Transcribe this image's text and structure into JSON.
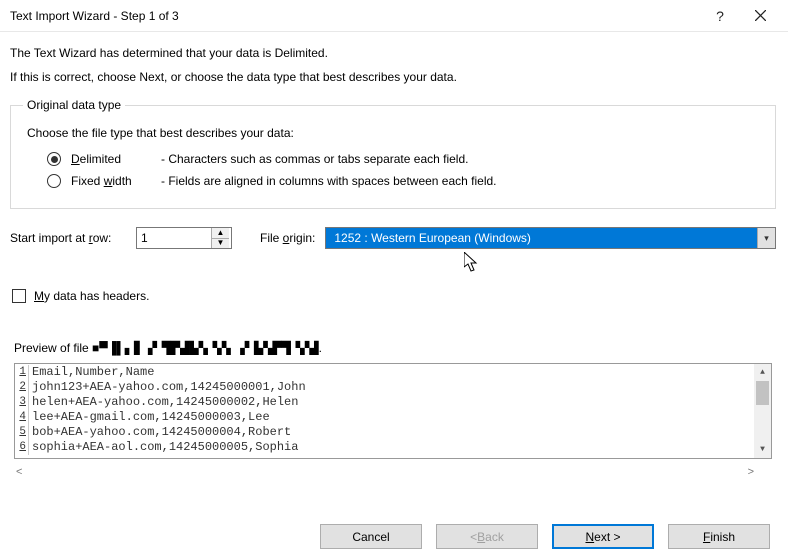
{
  "window": {
    "title": "Text Import Wizard - Step 1 of 3"
  },
  "intro": {
    "line1": "The Text Wizard has determined that your data is Delimited.",
    "line2": "If this is correct, choose Next, or choose the data type that best describes your data."
  },
  "group": {
    "legend": "Original data type",
    "prompt": "Choose the file type that best describes your data:",
    "delimited": {
      "key": "D",
      "rest": "elimited",
      "desc": "- Characters such as commas or tabs separate each field."
    },
    "fixed": {
      "pre": "Fixed ",
      "key": "w",
      "rest": "idth",
      "desc": "- Fields are aligned in columns with spaces between each field."
    }
  },
  "controls": {
    "start_label_pre": "Start import at ",
    "start_label_key": "r",
    "start_label_post": "ow:",
    "start_value": "1",
    "origin_pre": "File ",
    "origin_key": "o",
    "origin_post": "rigin:",
    "origin_value": "1252 : Western European (Windows)"
  },
  "headers": {
    "key": "M",
    "rest": "y data has headers."
  },
  "preview": {
    "label_prefix": "Preview of file ",
    "filename": "■▀▐▌▖▋▗▘▜▛▟▙▚▝▞▖▗▘▙▚▛▜▝▞▟.",
    "lines": [
      "Email,Number,Name",
      "john123+AEA-yahoo.com,14245000001,John",
      "helen+AEA-yahoo.com,14245000002,Helen",
      "lee+AEA-gmail.com,14245000003,Lee",
      "bob+AEA-yahoo.com,14245000004,Robert",
      "sophia+AEA-aol.com,14245000005,Sophia"
    ]
  },
  "buttons": {
    "cancel": "Cancel",
    "back_pre": "< ",
    "back_key": "B",
    "back_rest": "ack",
    "next_key": "N",
    "next_rest": "ext >",
    "finish_key": "F",
    "finish_rest": "inish"
  }
}
